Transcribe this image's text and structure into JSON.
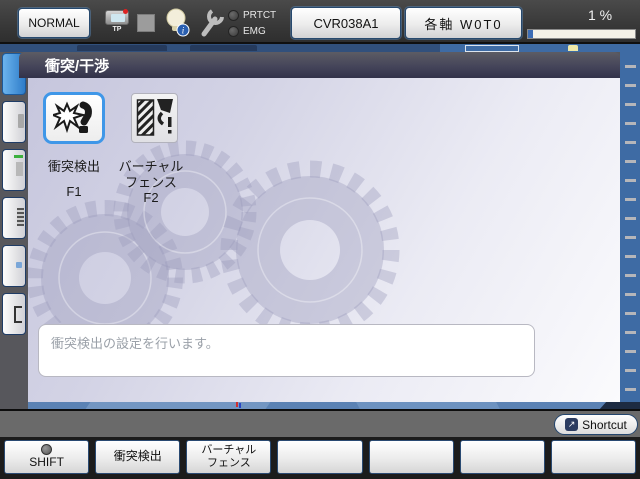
{
  "top_bar": {
    "mode_button": "NORMAL",
    "tp_icon_label": "TP",
    "prtct_label": "PRTCT",
    "emg_label": "EMG",
    "program_button": "CVR038A1",
    "motion_button": "各軸 W0T0",
    "speed_value": "1 %",
    "icons": [
      "teach-pendant-icon",
      "blank-square-icon",
      "lamp-info-icon",
      "wrench-icon"
    ]
  },
  "dialog": {
    "title": "衝突/干渉",
    "items": [
      {
        "label": "衝突検出",
        "fkey": "F1",
        "icon": "collision-burst-icon",
        "selected": true
      },
      {
        "label_line1": "バーチャル",
        "label_line2": "フェンス",
        "fkey": "F2",
        "icon": "virtual-fence-icon",
        "selected": false
      }
    ],
    "message": "衝突検出の設定を行います。"
  },
  "shortcut": {
    "label": "Shortcut",
    "icon": "shortcut-arrow-icon"
  },
  "function_keys": [
    {
      "label": "SHIFT",
      "led": true
    },
    {
      "label": "衝突検出"
    },
    {
      "label_line1": "バーチャル",
      "label_line2": "フェンス"
    },
    {
      "label": ""
    },
    {
      "label": ""
    },
    {
      "label": ""
    },
    {
      "label": ""
    }
  ],
  "colors": {
    "accent_blue": "#3f97e8",
    "steel_blue": "#3e6ba4",
    "title_bar_dark": "#32324a",
    "progress_fill": "#3c6cb4",
    "led_off": "#3a3a3a"
  }
}
